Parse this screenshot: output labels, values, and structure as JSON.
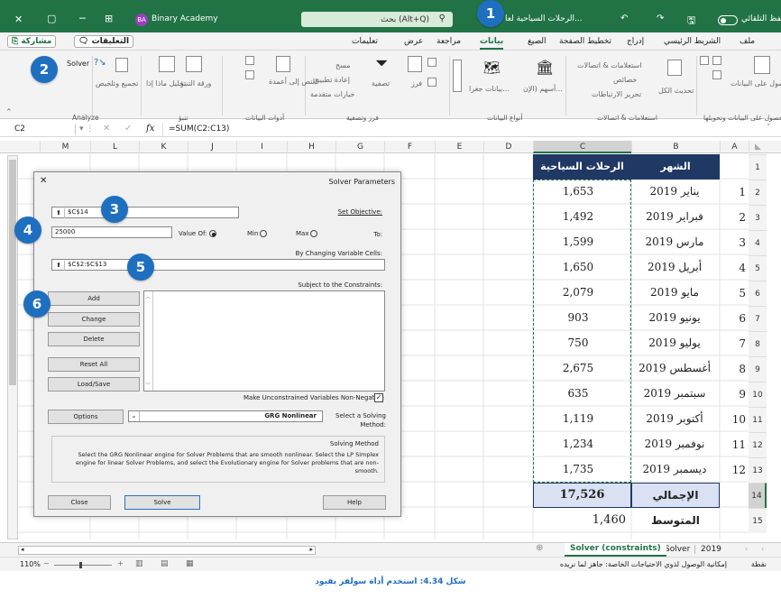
{
  "titlebar": {
    "filename": "الرحلات السياحية لعا...",
    "autosave": "الحفظ التلقائي",
    "search": "بحث (Alt+Q)",
    "user": "Binary Academy",
    "user_initials": "BA"
  },
  "tabs": [
    "ملف",
    "الشريط الرئيسي",
    "إدراج",
    "تخطيط الصفحة",
    "الصيغ",
    "بيانات",
    "مراجعة",
    "عرض",
    "تعليمات"
  ],
  "active_tab": "بيانات",
  "share_button": "مشاركة",
  "comments_button": "التعليقات",
  "ribbon": {
    "get_data": "الحصول على البيانات",
    "get_transform": "الحصول على البيانات وتحويلها",
    "queries_connections": "استعلامات & اتصالات",
    "properties": "خصائص",
    "edit_links": "تحرير الارتباطات",
    "refresh_all": "تحديث الكل",
    "queries_group": "استعلامات & اتصالات",
    "stocks": "أسهم (الإن...",
    "geography": "بيانات جغرا...",
    "data_types_group": "أنواع البيانات",
    "sort": "فرز",
    "filter": "تصفية",
    "clear": "مسح",
    "reapply": "إعادة تطبيق",
    "advanced": "خيارات متقدمة",
    "sort_filter_group": "فرز وتصفية",
    "text_to_columns": "النص إلى أعمدة",
    "data_tools_group": "أدوات البيانات",
    "what_if": "تحليل ماذا إذا",
    "forecast_sheet": "ورقة التنبؤ",
    "forecast_group": "تنبؤ",
    "outline": "تجميع وتلخيص",
    "solver": "Solver",
    "analyze_group": "Analyze"
  },
  "formula_bar": {
    "name_box": "C2",
    "formula": "=SUM(C2:C13)",
    "fx": "fx"
  },
  "columns": [
    "A",
    "B",
    "C",
    "D",
    "E",
    "F",
    "G",
    "H",
    "I",
    "J",
    "K",
    "L",
    "M"
  ],
  "headers": {
    "month": "الشهر",
    "trips": "الرحلات السياحية"
  },
  "rows": [
    {
      "n": "1",
      "month": "يناير 2019",
      "value": "1,653"
    },
    {
      "n": "2",
      "month": "فبراير 2019",
      "value": "1,492"
    },
    {
      "n": "3",
      "month": "مارس 2019",
      "value": "1,599"
    },
    {
      "n": "4",
      "month": "أبريل 2019",
      "value": "1,650"
    },
    {
      "n": "5",
      "month": "مايو 2019",
      "value": "2,079"
    },
    {
      "n": "6",
      "month": "يونيو 2019",
      "value": "903"
    },
    {
      "n": "7",
      "month": "يوليو 2019",
      "value": "750"
    },
    {
      "n": "8",
      "month": "أغسطس 2019",
      "value": "2,675"
    },
    {
      "n": "9",
      "month": "سبتمبر 2019",
      "value": "635"
    },
    {
      "n": "10",
      "month": "أكتوبر 2019",
      "value": "1,119"
    },
    {
      "n": "11",
      "month": "نوفمبر 2019",
      "value": "1,234"
    },
    {
      "n": "12",
      "month": "ديسمبر 2019",
      "value": "1,735"
    }
  ],
  "row_numbers": [
    "1",
    "2",
    "3",
    "4",
    "5",
    "6",
    "7",
    "8",
    "9",
    "10",
    "11",
    "12",
    "13",
    "14",
    "15"
  ],
  "total": {
    "label": "الإجمالي",
    "value": "17,526"
  },
  "average": {
    "label": "المتوسط",
    "value": "1,460"
  },
  "dialog": {
    "title": "Solver Parameters",
    "set_objective_label": "Set Objective:",
    "set_objective_value": "$C$14",
    "to_label": "To:",
    "max_label": "Max",
    "min_label": "Min",
    "value_of_label": "Value Of:",
    "value_of": "25000",
    "changing_label": "By Changing Variable Cells:",
    "changing_value": "$C$2:$C$13",
    "constraints_label": "Subject to the Constraints:",
    "add": "Add",
    "change": "Change",
    "delete": "Delete",
    "reset": "Reset All",
    "loadsave": "Load/Save",
    "nonneg": "Make Unconstrained Variables Non-Negative",
    "method_label": "Select a Solving Method:",
    "method_value": "GRG Nonlinear",
    "options": "Options",
    "solving_method_title": "Solving Method",
    "solving_method_text": "Select the GRG Nonlinear engine for Solver Problems that are smooth nonlinear. Select the LP Simplex engine for linear Solver Problems, and select the Evolutionary engine for Solver problems that are non-smooth.",
    "help": "Help",
    "solve": "Solve",
    "close": "Close"
  },
  "sheet_tabs": [
    "Solver (constraints)",
    "Solver",
    "2019"
  ],
  "active_sheet": "Solver (constraints)",
  "status": {
    "ready": "جاهز",
    "accessibility": "إمكانية الوصول لذوي الاحتياجات الخاصة: جاهز لما نريده",
    "mode": "نقطة",
    "zoom": "110%"
  },
  "caption": "شكل 4.34: استخدم أداة سولفر بقيود",
  "badges": [
    "1",
    "2",
    "3",
    "4",
    "5",
    "6"
  ],
  "colors": {
    "excel_green": "#217346",
    "badge_blue": "#1f6fc0",
    "header_navy": "#1f3864",
    "total_fill": "#d9e1f2"
  }
}
